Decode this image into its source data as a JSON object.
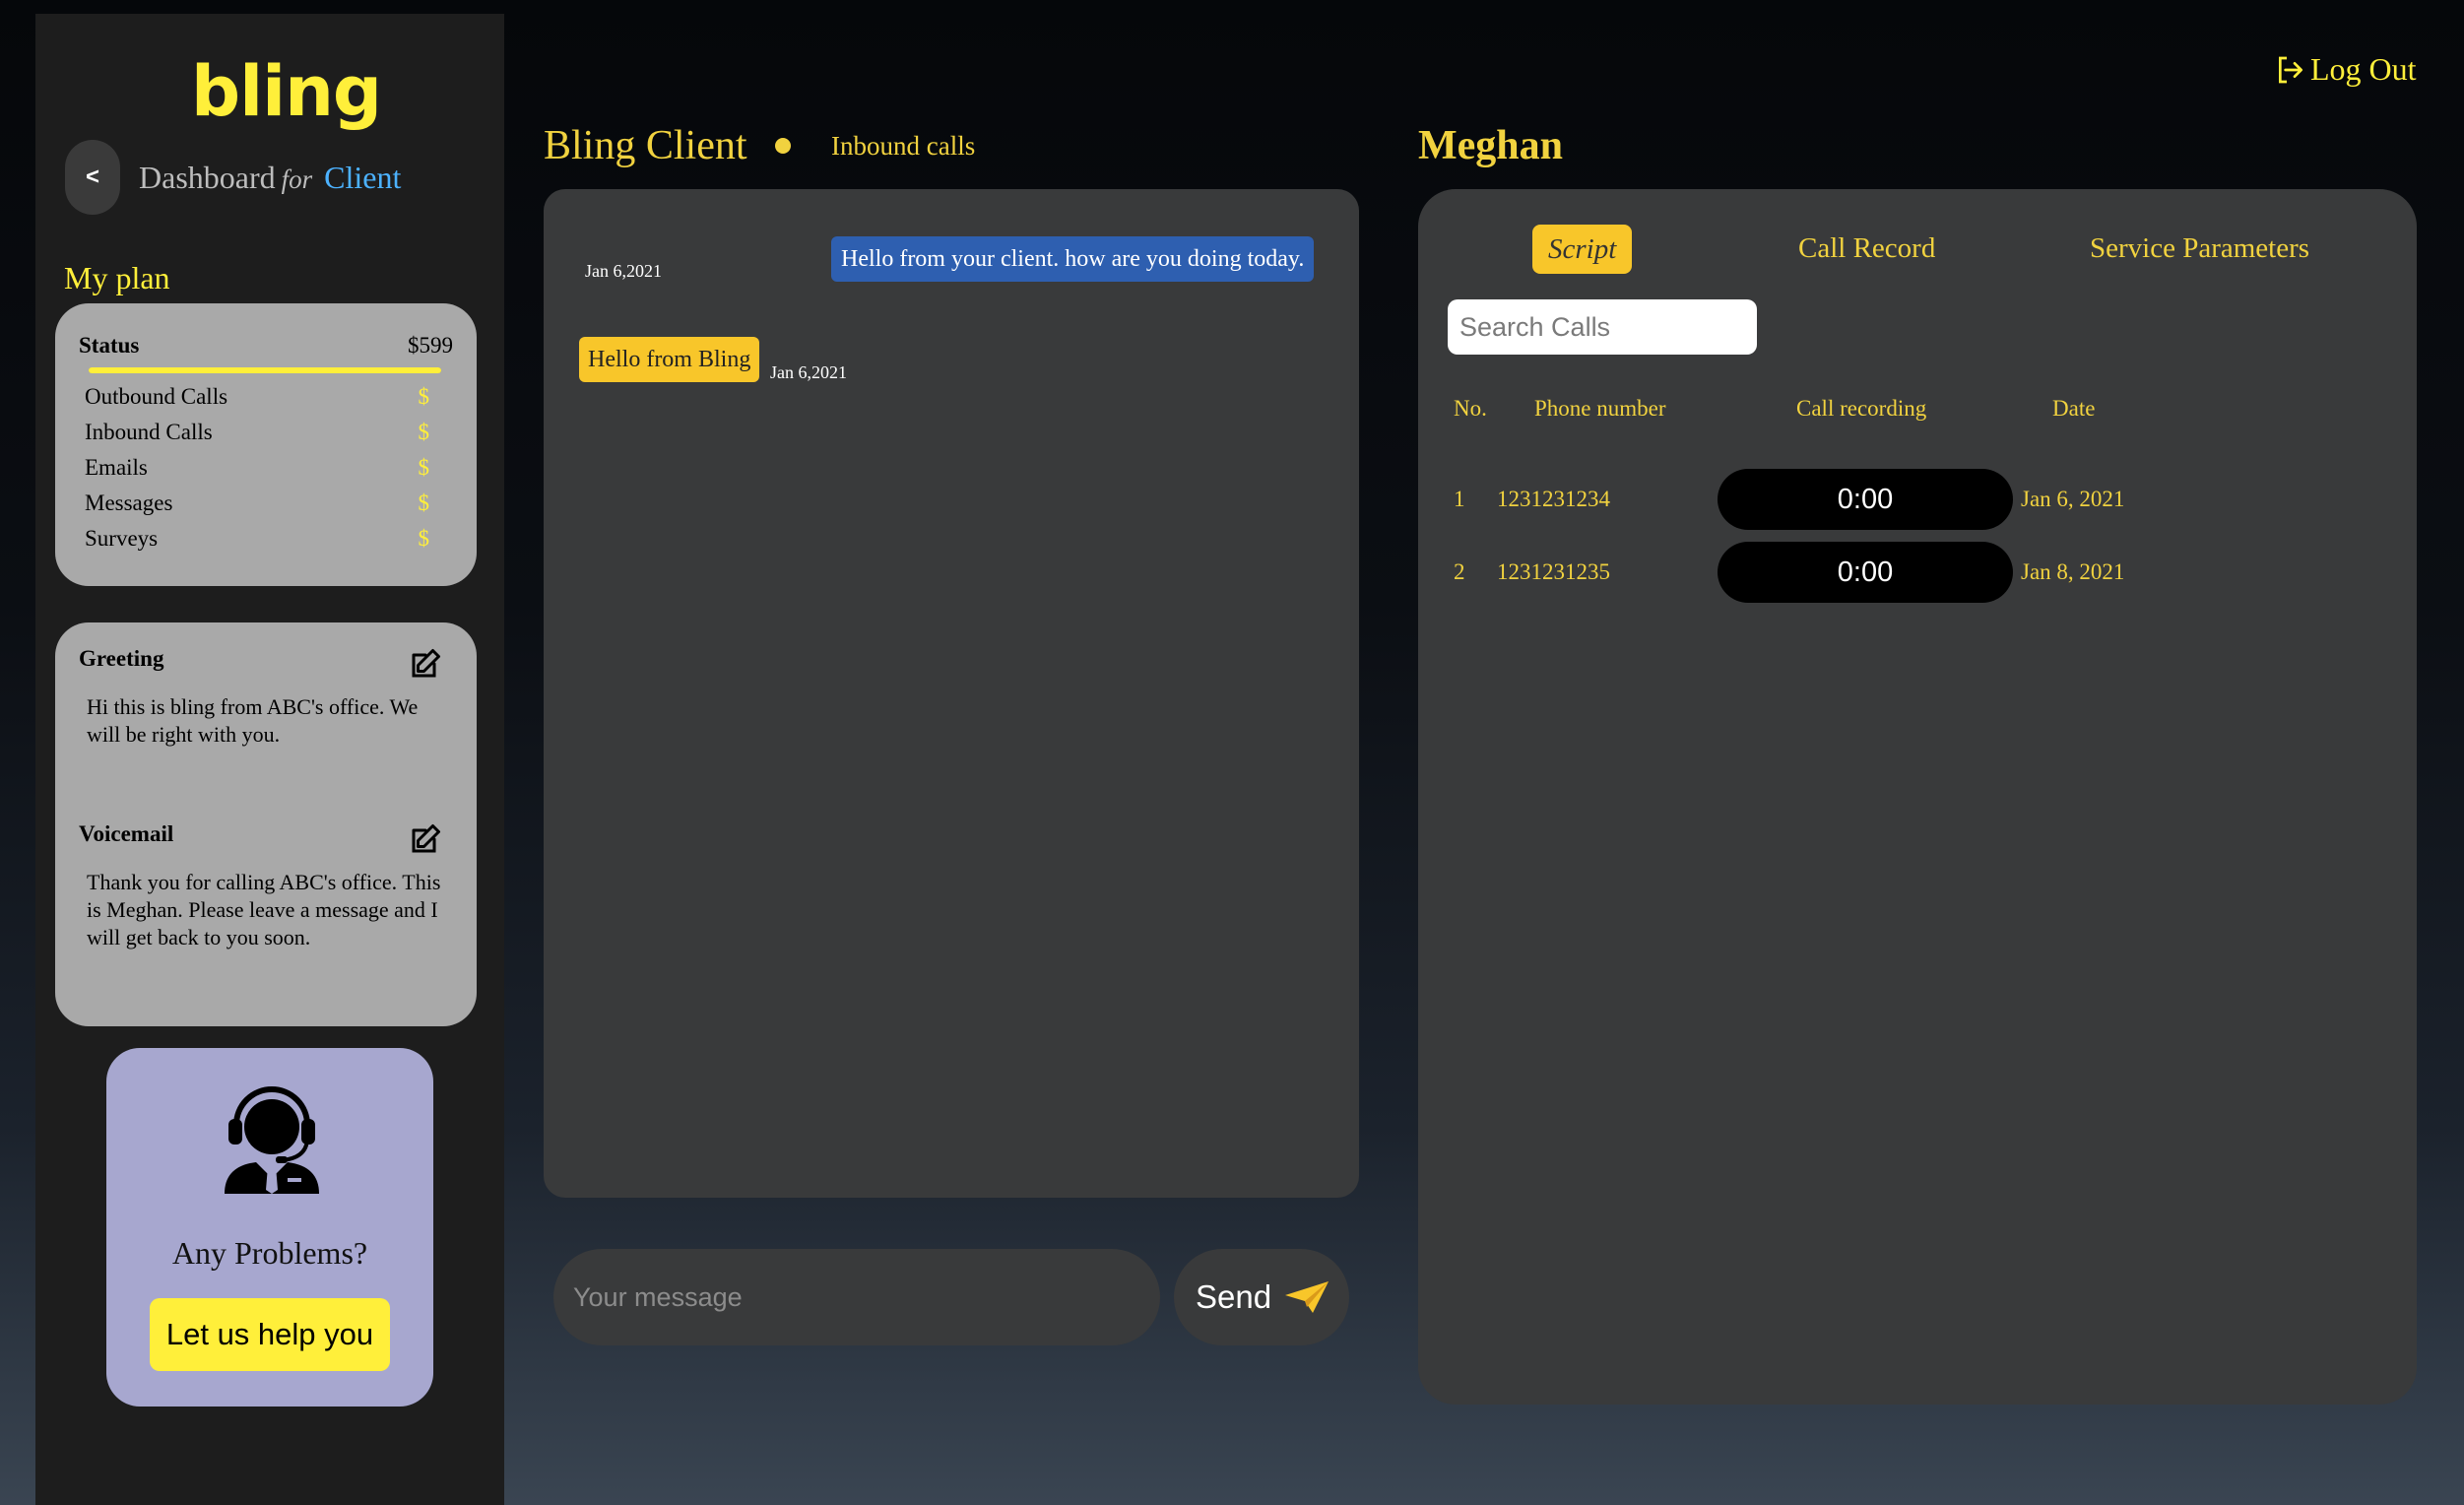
{
  "app": {
    "logo": "bling",
    "logout_label": "Log Out"
  },
  "sidebar": {
    "back_label": "<",
    "dashboard_label": "Dashboard",
    "for_label": "for",
    "role_label": "Client",
    "my_plan_label": "My plan",
    "plan": {
      "status_label": "Status",
      "status_value": "$599",
      "progress_percent": 100,
      "items": [
        {
          "label": "Outbound Calls",
          "value": "$"
        },
        {
          "label": "Inbound Calls",
          "value": "$"
        },
        {
          "label": "Emails",
          "value": "$"
        },
        {
          "label": "Messages",
          "value": "$"
        },
        {
          "label": "Surveys",
          "value": "$"
        }
      ]
    },
    "greeting": {
      "title": "Greeting",
      "text": "Hi this is bling from ABC's office. We will be right with you."
    },
    "voicemail": {
      "title": "Voicemail",
      "text": "Thank you for calling ABC's office. This is Meghan. Please leave a message and I will get back to you soon."
    },
    "help": {
      "question": "Any Problems?",
      "button_label": "Let us help you"
    }
  },
  "chat": {
    "title": "Bling Client",
    "subtitle": "Inbound calls",
    "messages": [
      {
        "from": "client",
        "text": "Hello from your client. how are you doing today.",
        "date": "Jan 6,2021"
      },
      {
        "from": "bling",
        "text": "Hello from Bling",
        "date": "Jan 6,2021"
      }
    ],
    "input_placeholder": "Your message",
    "send_label": "Send"
  },
  "detail": {
    "name": "Meghan",
    "tabs": [
      {
        "label": "Script",
        "active": true
      },
      {
        "label": "Call Record",
        "active": false
      },
      {
        "label": "Service Parameters",
        "active": false
      }
    ],
    "search_placeholder": "Search Calls",
    "columns": [
      "No.",
      "Phone number",
      "Call recording",
      "Date"
    ],
    "rows": [
      {
        "no": "1",
        "phone": "1231231234",
        "recording": "0:00",
        "date": "Jan 6, 2021"
      },
      {
        "no": "2",
        "phone": "1231231235",
        "recording": "0:00",
        "date": "Jan 8, 2021"
      }
    ]
  },
  "colors": {
    "accent_yellow": "#ffef3a",
    "gold": "#f1d23f",
    "client_bubble": "#2e5fb0",
    "panel": "#393a3b",
    "card_gray": "#a9a9a9",
    "help_card": "#a7a7cf",
    "link_blue": "#4cb2ff"
  }
}
